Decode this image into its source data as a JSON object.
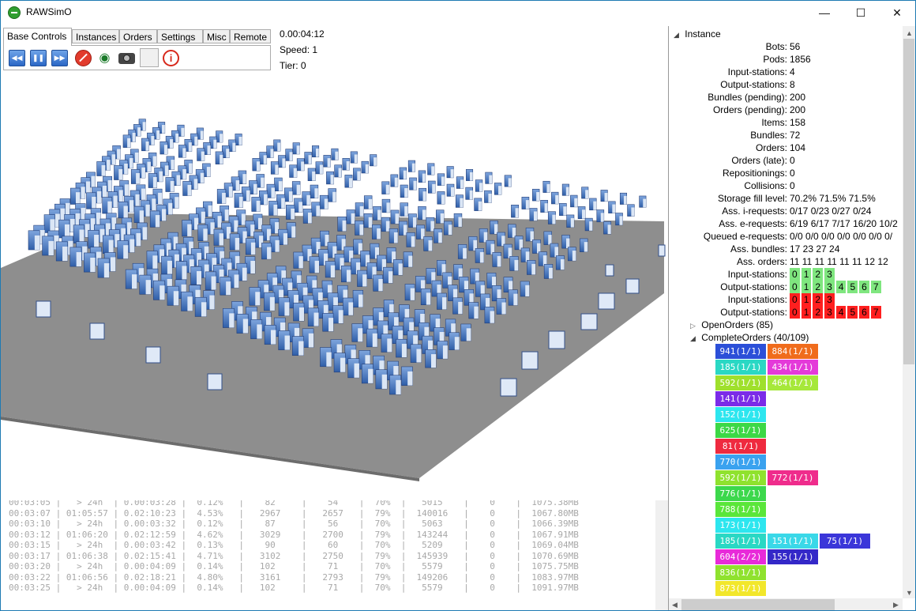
{
  "app": {
    "title": "RAWSimO"
  },
  "window_controls": {
    "minimize": "—",
    "maximize": "☐",
    "close": "✕"
  },
  "tabs": [
    "Base Controls",
    "Instances",
    "Orders",
    "Settings",
    "Misc",
    "Remote"
  ],
  "status": {
    "time": "0.00:04:12",
    "speed": "Speed: 1",
    "tier": "Tier: 0"
  },
  "toolbar": {
    "rewind": "rewind-icon",
    "pause": "pause-icon",
    "forward": "fast-forward-icon",
    "stop": "stop-icon",
    "visibility": "eye-icon",
    "screenshot": "camera-icon",
    "info": "i"
  },
  "instance": {
    "header": "Instance",
    "rows": [
      {
        "k": "Bots:",
        "v": "56"
      },
      {
        "k": "Pods:",
        "v": "1856"
      },
      {
        "k": "Input-stations:",
        "v": "4"
      },
      {
        "k": "Output-stations:",
        "v": "8"
      },
      {
        "k": "Bundles (pending):",
        "v": "200"
      },
      {
        "k": "Orders (pending):",
        "v": "200"
      },
      {
        "k": "Items:",
        "v": "158"
      },
      {
        "k": "Bundles:",
        "v": "72"
      },
      {
        "k": "Orders:",
        "v": "104"
      },
      {
        "k": "Orders (late):",
        "v": "0"
      },
      {
        "k": "Repositionings:",
        "v": "0"
      },
      {
        "k": "Collisions:",
        "v": "0"
      },
      {
        "k": "Storage fill level:",
        "v": "70.2% 71.5% 71.5%"
      },
      {
        "k": "Ass. i-requests:",
        "v": "0/17 0/23 0/27 0/24"
      },
      {
        "k": "Ass. e-requests:",
        "v": "6/19 6/17 7/17 16/20 10/2"
      },
      {
        "k": "Queued e-requests:",
        "v": "0/0 0/0 0/0 0/0 0/0 0/0 0/"
      },
      {
        "k": "Ass. bundles:",
        "v": "17 23 27 24"
      },
      {
        "k": "Ass. orders:",
        "v": "11 11 11 11 11 11 12 12"
      }
    ],
    "station_rows": [
      {
        "k": "Input-stations:",
        "cells": [
          "0",
          "1",
          "2",
          "3"
        ],
        "color": "green"
      },
      {
        "k": "Output-stations:",
        "cells": [
          "0",
          "1",
          "2",
          "3",
          "4",
          "5",
          "6",
          "7"
        ],
        "color": "green"
      },
      {
        "k": "Input-stations:",
        "cells": [
          "0",
          "1",
          "2",
          "3"
        ],
        "color": "red"
      },
      {
        "k": "Output-stations:",
        "cells": [
          "0",
          "1",
          "2",
          "3",
          "4",
          "5",
          "6",
          "7"
        ],
        "color": "red"
      }
    ]
  },
  "open_orders": "OpenOrders (85)",
  "complete_orders": "CompleteOrders (40/109)",
  "orders_grid": [
    [
      {
        "t": "941(1/1)",
        "c": "#2b4fd8"
      },
      {
        "t": "884(1/1)",
        "c": "#f06c1c"
      }
    ],
    [
      {
        "t": "185(1/1)",
        "c": "#2ad8c4"
      },
      {
        "t": "434(1/1)",
        "c": "#e43ad9"
      }
    ],
    [
      {
        "t": "592(1/1)",
        "c": "#9fe02c"
      },
      {
        "t": "464(1/1)",
        "c": "#a6e83a"
      }
    ],
    [
      {
        "t": "141(1/1)",
        "c": "#7b2be8"
      }
    ],
    [
      {
        "t": "152(1/1)",
        "c": "#2de6ef"
      }
    ],
    [
      {
        "t": "625(1/1)",
        "c": "#3cd846"
      }
    ],
    [
      {
        "t": "81(1/1)",
        "c": "#ef2a3f"
      }
    ],
    [
      {
        "t": "770(1/1)",
        "c": "#3aa2ef"
      }
    ],
    [
      {
        "t": "592(1/1)",
        "c": "#8fe22e"
      },
      {
        "t": "772(1/1)",
        "c": "#ef2c8c"
      }
    ],
    [
      {
        "t": "776(1/1)",
        "c": "#3cd84c"
      }
    ],
    [
      {
        "t": "788(1/1)",
        "c": "#5ae63a"
      }
    ],
    [
      {
        "t": "173(1/1)",
        "c": "#2de6ef"
      }
    ],
    [
      {
        "t": "185(1/1)",
        "c": "#2ad8c4"
      },
      {
        "t": "151(1/1)",
        "c": "#3ad8e8"
      },
      {
        "t": "75(1/1)",
        "c": "#3b36d9"
      }
    ],
    [
      {
        "t": "604(2/2)",
        "c": "#e82ad9"
      },
      {
        "t": "155(1/1)",
        "c": "#3428c8"
      }
    ],
    [
      {
        "t": "836(1/1)",
        "c": "#8fe22e"
      }
    ],
    [
      {
        "t": "873(1/1)",
        "c": "#f2e72b"
      }
    ]
  ],
  "log_lines": [
    "00:03:05 |   > 24h  | 0.00:03:28 |  0.12%   |    82     |    54    |  70%  |   5015    |    0    |  1075.38MB",
    "00:03:07 | 01:05:57 | 0.02:10:23 |  4.53%   |   2967    |   2657   |  79%  |  140016   |    0    |  1067.80MB",
    "00:03:10 |   > 24h  | 0.00:03:32 |  0.12%   |    87     |    56    |  70%  |   5063    |    0    |  1066.39MB",
    "00:03:12 | 01:06:20 | 0.02:12:59 |  4.62%   |   3029    |   2700   |  79%  |  143244   |    0    |  1067.91MB",
    "00:03:15 |   > 24h  | 0.00:03:42 |  0.13%   |    90     |    60    |  70%  |   5209    |    0    |  1069.04MB",
    "00:03:17 | 01:06:38 | 0.02:15:41 |  4.71%   |   3102    |   2750   |  79%  |  145939   |    0    |  1070.69MB",
    "00:03:20 |   > 24h  | 0.00:04:09 |  0.14%   |   102     |    71    |  70%  |   5579    |    0    |  1075.75MB",
    "00:03:22 | 01:06:56 | 0.02:18:21 |  4.80%   |   3161    |   2793   |  79%  |  149206   |    0    |  1083.97MB",
    "00:03:25 |   > 24h  | 0.00:04:09 |  0.14%   |   102     |    71    |  70%  |   5579    |    0    |  1091.97MB"
  ]
}
